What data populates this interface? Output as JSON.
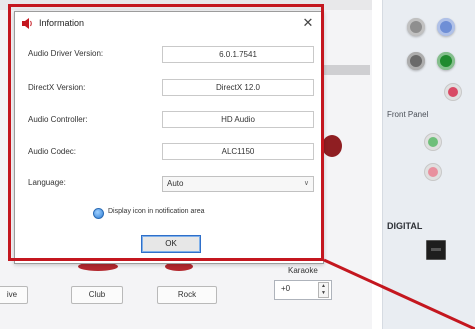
{
  "dialog": {
    "title": "Information",
    "close_glyph": "✕",
    "rows": [
      {
        "label": "Audio Driver Version:",
        "value": "6.0.1.7541"
      },
      {
        "label": "DirectX Version:",
        "value": "DirectX 12.0"
      },
      {
        "label": "Audio Controller:",
        "value": "HD Audio"
      },
      {
        "label": "Audio Codec:",
        "value": "ALC1150"
      }
    ],
    "language": {
      "label": "Language:",
      "selected": "Auto"
    },
    "tray_option": "Display icon in notification area",
    "ok_label": "OK"
  },
  "background": {
    "eq_buttons": [
      "ive",
      "Club",
      "Rock"
    ],
    "karaoke": {
      "label": "Karaoke",
      "value": "+0"
    }
  },
  "right_panel": {
    "front_panel_label": "Front Panel",
    "digital_label": "DIGITAL"
  },
  "colors": {
    "highlight": "#c4171f",
    "jack_rear_grey": "#8f8f8f",
    "jack_blue": "#6f8fd6",
    "jack_green": "#1f8a2e",
    "jack_pink": "#d84a64",
    "jack_front_green": "#6fbf7a",
    "jack_front_pink": "#e8909e"
  },
  "icons": {
    "title": "speaker-icon",
    "close": "close-icon",
    "dropdown": "chevron-down-icon",
    "tray": "radio-dot-icon",
    "spin": "spin-arrows-icon",
    "digital": "optical-port-icon"
  }
}
